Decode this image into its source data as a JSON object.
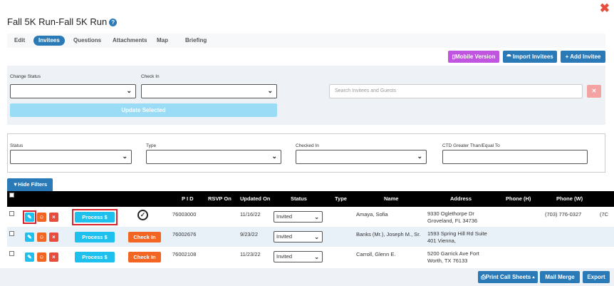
{
  "title": "Fall 5K Run-Fall 5K Run",
  "tabs": [
    "Edit",
    "Invitees",
    "Questions",
    "Attachments",
    "Map",
    "Briefing"
  ],
  "actions": {
    "mobile": "Mobile Version",
    "import": "Import Invitees",
    "add": "+ Add Invitee"
  },
  "filters": {
    "change_status": "Change Status",
    "check_in": "Check In",
    "search_placeholder": "Search Invitees and Guests",
    "update": "Update Selected",
    "status": "Status",
    "type": "Type",
    "checked_in": "Checked In",
    "ctd": "CTD Greater Than/Equal To",
    "hide": "Hide Filters"
  },
  "columns": {
    "pid": "P I D",
    "rsvp": "RSVP On",
    "updated": "Updated On",
    "status": "Status",
    "type": "Type",
    "name": "Name",
    "address": "Address",
    "phone_h": "Phone (H)",
    "phone_w": "Phone (W)"
  },
  "rows": [
    {
      "pid": "76003000",
      "updated": "11/16/22",
      "status": "Invited",
      "name": "Amaya, Sofia",
      "addr1": "9330 Oglethorpe Dr",
      "addr2": "Groveland, FL 34736",
      "phone_w": "(703) 776-0327",
      "extra": "(7C",
      "process": "Process $",
      "check": "checked"
    },
    {
      "pid": "76002676",
      "updated": "9/23/22",
      "status": "Invited",
      "name": "Banks (Mr.), Joseph M., Sr.",
      "addr1": "1593 Spring Hill Rd Suite",
      "addr2": "401 Vienna,",
      "phone_w": "",
      "extra": "",
      "process": "Process $",
      "check": "Check In"
    },
    {
      "pid": "76002108",
      "updated": "11/23/22",
      "status": "Invited",
      "name": "Carroll, Glenn E.",
      "addr1": "5200 Garrick Ave Fort",
      "addr2": "Worth, TX 76133",
      "phone_w": "",
      "extra": "",
      "process": "Process $",
      "check": "Check In"
    }
  ],
  "footer": {
    "print": "Print Call Sheets",
    "mail": "Mail Merge",
    "export": "Export"
  },
  "colors": {
    "primary": "#2a7ab8",
    "cyan": "#1ec0ee",
    "orange": "#f26522",
    "purple": "#c055e0",
    "red": "#e74c3c"
  }
}
